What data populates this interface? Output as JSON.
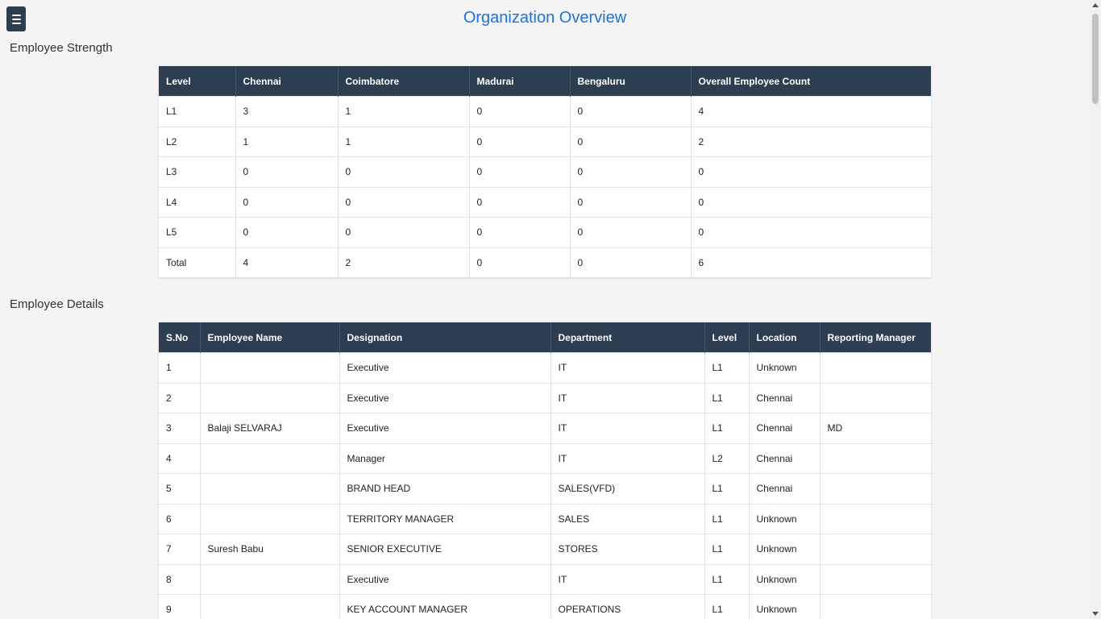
{
  "header": {
    "title": "Organization Overview",
    "menu_icon": "hamburger-menu-icon"
  },
  "strength": {
    "title": "Employee Strength",
    "columns": [
      "Level",
      "Chennai",
      "Coimbatore",
      "Madurai",
      "Bengaluru",
      "Overall Employee Count"
    ],
    "rows": [
      [
        "L1",
        "3",
        "1",
        "0",
        "0",
        "4"
      ],
      [
        "L2",
        "1",
        "1",
        "0",
        "0",
        "2"
      ],
      [
        "L3",
        "0",
        "0",
        "0",
        "0",
        "0"
      ],
      [
        "L4",
        "0",
        "0",
        "0",
        "0",
        "0"
      ],
      [
        "L5",
        "0",
        "0",
        "0",
        "0",
        "0"
      ],
      [
        "Total",
        "4",
        "2",
        "0",
        "0",
        "6"
      ]
    ]
  },
  "details": {
    "title": "Employee Details",
    "columns": [
      "S.No",
      "Employee Name",
      "Designation",
      "Department",
      "Level",
      "Location",
      "Reporting Manager"
    ],
    "rows": [
      [
        "1",
        "",
        "Executive",
        "IT",
        "L1",
        "Unknown",
        ""
      ],
      [
        "2",
        "",
        "Executive",
        "IT",
        "L1",
        "Chennai",
        ""
      ],
      [
        "3",
        "Balaji SELVARAJ",
        "Executive",
        "IT",
        "L1",
        "Chennai",
        "MD"
      ],
      [
        "4",
        "",
        "Manager",
        "IT",
        "L2",
        "Chennai",
        ""
      ],
      [
        "5",
        "",
        "BRAND HEAD",
        "SALES(VFD)",
        "L1",
        "Chennai",
        ""
      ],
      [
        "6",
        "",
        "TERRITORY MANAGER",
        "SALES",
        "L1",
        "Unknown",
        ""
      ],
      [
        "7",
        "Suresh Babu",
        "SENIOR EXECUTIVE",
        "STORES",
        "L1",
        "Unknown",
        ""
      ],
      [
        "8",
        "",
        "Executive",
        "IT",
        "L1",
        "Unknown",
        ""
      ],
      [
        "9",
        "",
        "KEY ACCOUNT MANAGER",
        "OPERATIONS",
        "L1",
        "Unknown",
        ""
      ]
    ]
  },
  "colors": {
    "header_bg": "#2c3e50",
    "title_blue": "#1a73e8",
    "page_bg": "#f4f4f4"
  }
}
